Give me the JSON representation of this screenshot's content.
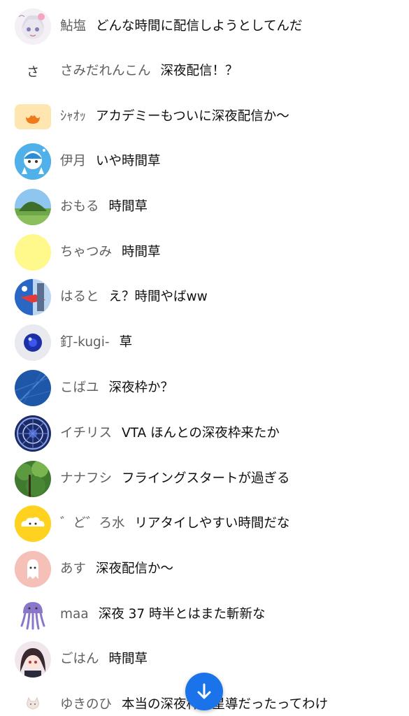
{
  "chat": {
    "messages": [
      {
        "author": "鮎塩",
        "text": "どんな時間に配信しようとしてんだ",
        "avatar": "anime-girl-white-hair-avatar"
      },
      {
        "author": "さみだれんこん",
        "text": "深夜配信！？",
        "avatar": "letter-sa-avatar",
        "avatar_letter": "さ"
      },
      {
        "author": "ｼｬｵｯ",
        "text": "アカデミーもついに深夜配信か〜",
        "avatar": "orange-flower-avatar"
      },
      {
        "author": "伊月",
        "text": "いや時間草",
        "avatar": "blue-character-peace-avatar"
      },
      {
        "author": "おもる",
        "text": "時間草",
        "avatar": "green-hill-landscape-avatar"
      },
      {
        "author": "ちゃつみ",
        "text": "時間草",
        "avatar": "plain-yellow-avatar"
      },
      {
        "author": "はると",
        "text": "え？時間やばww",
        "avatar": "red-blue-illustration-avatar"
      },
      {
        "author": "釘-kugi-",
        "text": "草",
        "avatar": "blue-orb-avatar"
      },
      {
        "author": "こばユ",
        "text": "深夜枠か？",
        "avatar": "blue-umbrella-avatar"
      },
      {
        "author": "イチリス",
        "text": "VTA ほんとの深夜枠来たか",
        "avatar": "stained-glass-avatar"
      },
      {
        "author": "ナナフシ",
        "text": "フライングスタートが過ぎる",
        "avatar": "forest-trees-avatar"
      },
      {
        "author": "゛ど゛ろ水",
        "text": "リアタイしやすい時間だな",
        "avatar": "yellow-cloud-avatar"
      },
      {
        "author": "あす",
        "text": "深夜配信か〜",
        "avatar": "pink-ghost-avatar"
      },
      {
        "author": "maa",
        "text": "深夜 37 時半とはまた斬新な",
        "avatar": "purple-jellyfish-avatar"
      },
      {
        "author": "ごはん",
        "text": "時間草",
        "avatar": "anime-character-dark-hair-avatar"
      },
      {
        "author": "ゆきのひ",
        "text": "本当の深夜枠は星導だったってわけ",
        "avatar": "white-cat-avatar"
      }
    ]
  },
  "scroll_button": {
    "icon": "arrow-down-icon",
    "color": "#1a73e8"
  }
}
